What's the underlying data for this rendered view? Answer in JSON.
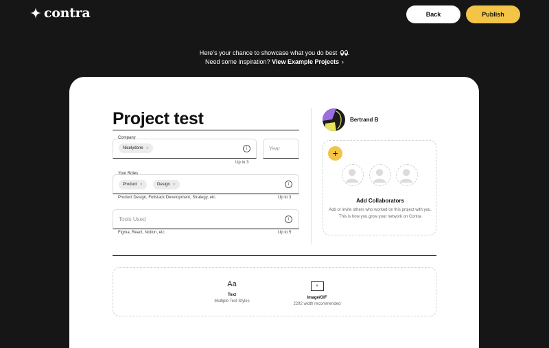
{
  "brand": {
    "name": "contra"
  },
  "header": {
    "back_label": "Back",
    "publish_label": "Publish"
  },
  "intro": {
    "line1": "Here’s your chance to showcase what you do best",
    "line2_prefix": "Need some inspiration?",
    "link_label": "View Example Projects"
  },
  "project": {
    "title": "Project test"
  },
  "company": {
    "label": "Company",
    "chips": [
      "Nicelydone"
    ],
    "hint": "Up to 3",
    "year_placeholder": "Year"
  },
  "roles": {
    "label": "Your Roles",
    "chips": [
      "Product",
      "Design"
    ],
    "examples": "Product Design, Fullstack Development, Strategy, etc.",
    "hint": "Up to 3"
  },
  "tools": {
    "placeholder": "Tools Used",
    "examples": "Figma, React, Notion, etc.",
    "hint": "Up to 5"
  },
  "user": {
    "name": "Bertrand B"
  },
  "collaborators": {
    "title": "Add Collaborators",
    "description": "Add or invite others who worked on this project with you. This is how you grow your network on Contra"
  },
  "blocks": [
    {
      "icon_text": "Aa",
      "title": "Text",
      "subtitle": "Multiple Text Styles"
    },
    {
      "icon_text": "+",
      "title": "Image/GIF",
      "subtitle": "2292 width recommended"
    }
  ],
  "colors": {
    "background": "#161616",
    "accent": "#f3c445",
    "card": "#ffffff"
  }
}
